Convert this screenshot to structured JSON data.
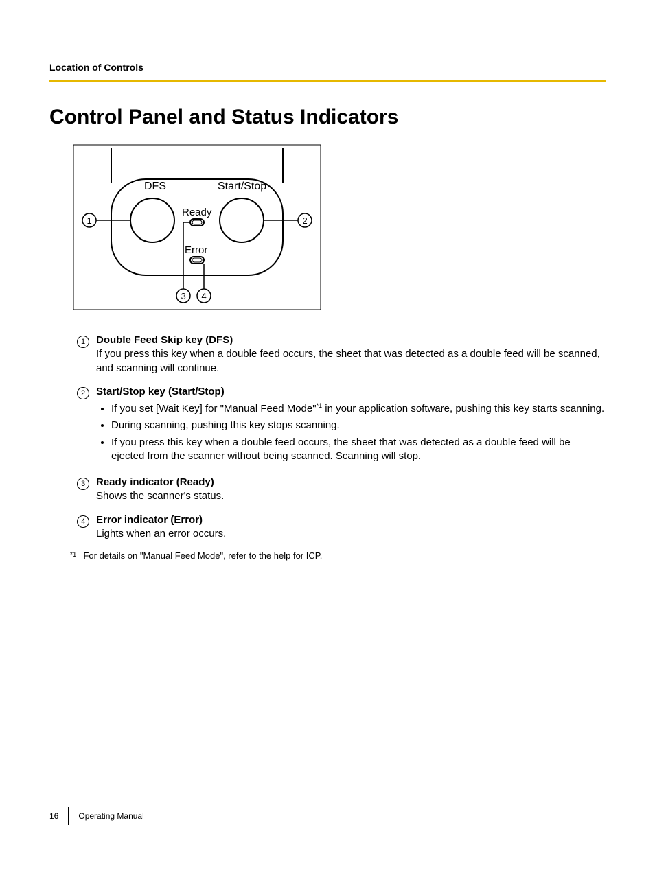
{
  "breadcrumb": "Location of Controls",
  "title": "Control Panel and Status Indicators",
  "diagram": {
    "labels": {
      "dfs": "DFS",
      "startstop": "Start/Stop",
      "ready": "Ready",
      "error": "Error"
    },
    "callouts": {
      "one": "1",
      "two": "2",
      "three": "3",
      "four": "4"
    }
  },
  "items": [
    {
      "num": "1",
      "title": "Double Feed Skip key (DFS)",
      "text": "If you press this key when a double feed occurs, the sheet that was detected as a double feed will be scanned, and scanning will continue."
    },
    {
      "num": "2",
      "title": "Start/Stop key (Start/Stop)",
      "bullets": [
        {
          "pre": "If you set [Wait Key] for \"Manual Feed Mode\"",
          "fn": "*1",
          "post": " in your application software, pushing this key starts scanning."
        },
        {
          "pre": "During scanning, pushing this key stops scanning.",
          "fn": "",
          "post": ""
        },
        {
          "pre": "If you press this key when a double feed occurs, the sheet that was detected as a double feed will be ejected from the scanner without being scanned. Scanning will stop.",
          "fn": "",
          "post": ""
        }
      ]
    },
    {
      "num": "3",
      "title": "Ready indicator (Ready)",
      "text": "Shows the scanner's status."
    },
    {
      "num": "4",
      "title": "Error indicator (Error)",
      "text": "Lights when an error occurs."
    }
  ],
  "footnote": {
    "mark": "*1",
    "text": "For details on \"Manual Feed Mode\", refer to the help for ICP."
  },
  "footer": {
    "page": "16",
    "manual": "Operating Manual"
  }
}
